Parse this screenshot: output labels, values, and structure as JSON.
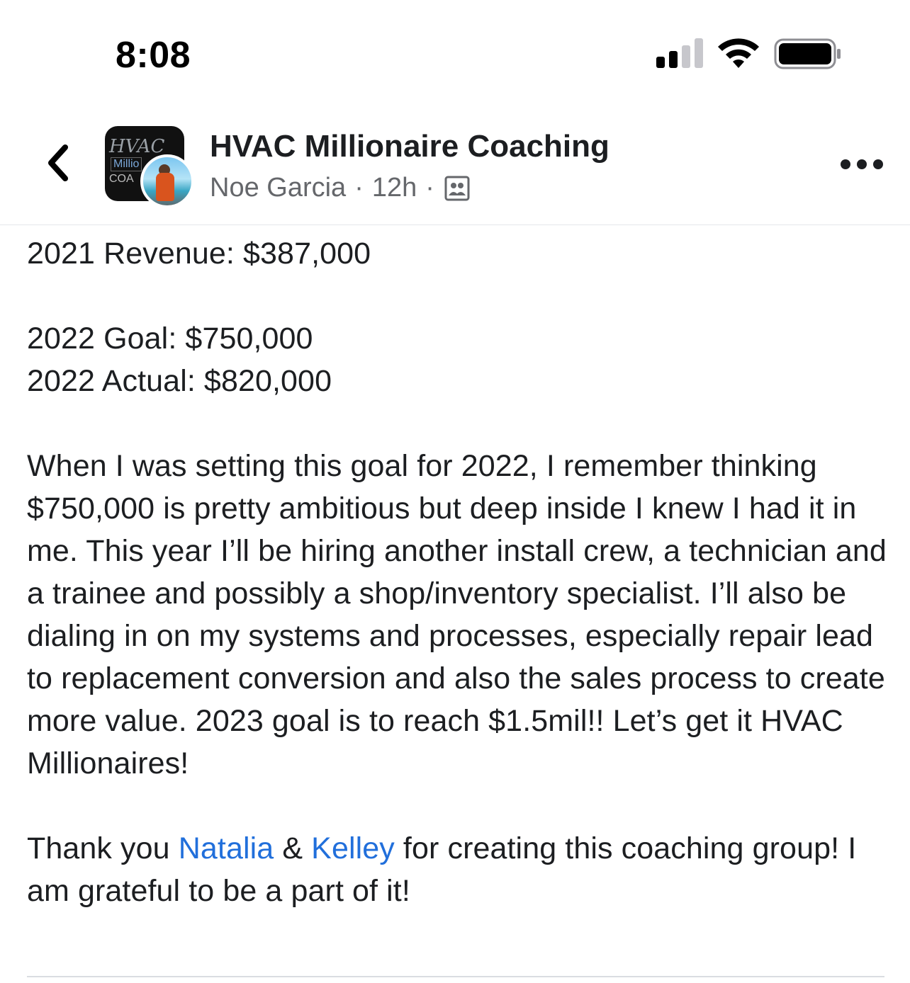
{
  "status_bar": {
    "time": "8:08",
    "signal_icon": "cellular-signal-icon",
    "wifi_icon": "wifi-icon",
    "battery_icon": "battery-icon"
  },
  "header": {
    "back_icon": "chevron-left-icon",
    "group_name": "HVAC Millionaire Coaching",
    "group_logo_text": [
      "HVAC",
      "Millio",
      "COA"
    ],
    "author": "Noe Garcia",
    "separator": "·",
    "time_ago": "12h",
    "audience_icon": "group-members-icon",
    "more_icon": "more-horizontal-icon"
  },
  "post": {
    "line_revenue_2021": "2021 Revenue: $387,000",
    "line_goal_2022": "2022 Goal: $750,000",
    "line_actual_2022": "2022 Actual: $820,000",
    "paragraph": "When I was setting this goal for 2022, I remember thinking $750,000 is pretty ambitious but deep inside I knew I had it in me. This year I’ll be hiring another install crew, a technician and a trainee and possibly a shop/inventory specialist. I’ll also be dialing in on my systems and processes, especially repair lead to replacement conversion and also the sales process to create more value. 2023 goal is to reach $1.5mil!! Let’s get it HVAC Millionaires!",
    "thanks_prefix": "Thank you ",
    "mention_1": "Natalia",
    "thanks_and": " & ",
    "mention_2": "Kelley",
    "thanks_suffix": " for creating this coaching group! I am grateful to be a part of it!"
  },
  "colors": {
    "text": "#1c1e21",
    "secondary": "#65676b",
    "mention": "#216fdb",
    "divider": "#e4e6eb"
  }
}
